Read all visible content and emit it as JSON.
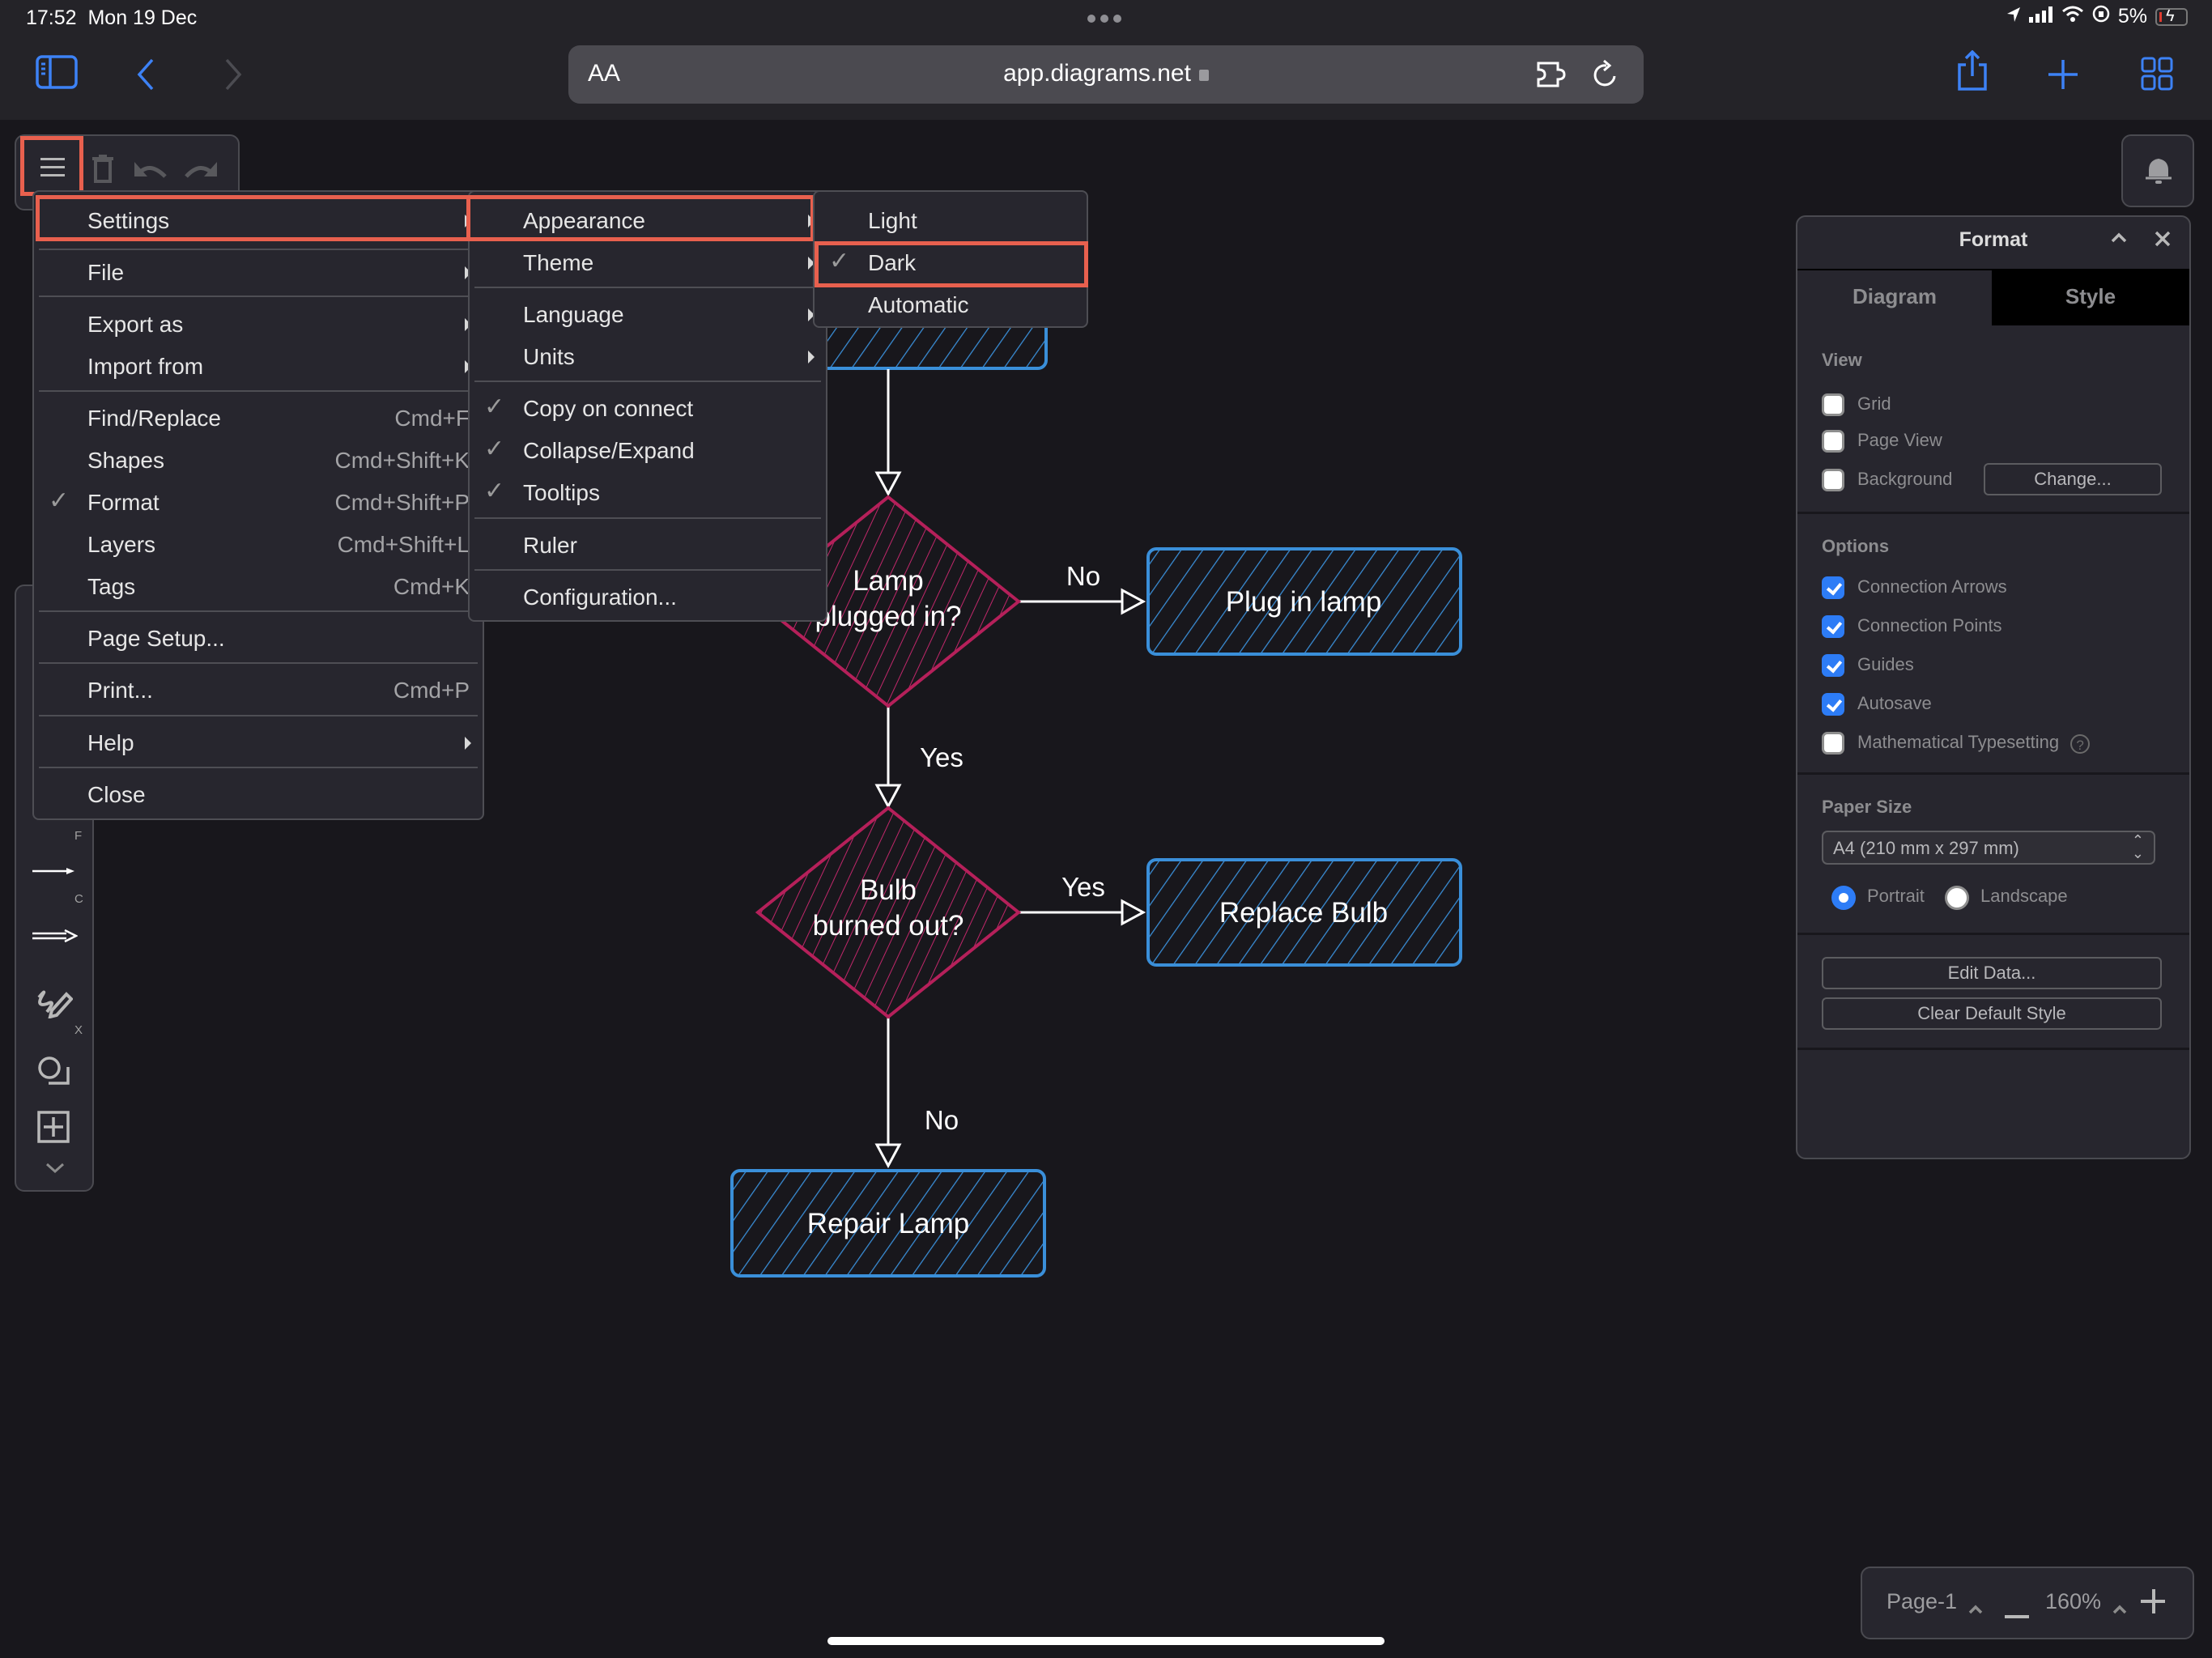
{
  "status_bar": {
    "time": "17:52",
    "date": "Mon 19 Dec",
    "battery": "5%"
  },
  "browser": {
    "text_size_label": "AA",
    "url": "app.diagrams.net",
    "icons": [
      "sidebar-icon",
      "back-icon",
      "forward-icon",
      "extension-icon",
      "reload-icon",
      "share-icon",
      "new-tab-icon",
      "tabs-overview-icon"
    ]
  },
  "toolbar": {
    "icons": [
      "menu-icon",
      "delete-icon",
      "undo-icon",
      "redo-icon"
    ]
  },
  "main_menu": {
    "items": [
      {
        "label": "Settings",
        "submenu": true,
        "highlighted": true
      },
      {
        "label": "File",
        "submenu": true
      },
      {
        "label": "Export as",
        "submenu": true
      },
      {
        "label": "Import from",
        "submenu": true
      },
      {
        "label": "Find/Replace",
        "shortcut": "Cmd+F"
      },
      {
        "label": "Shapes",
        "shortcut": "Cmd+Shift+K"
      },
      {
        "label": "Format",
        "shortcut": "Cmd+Shift+P",
        "checked": true
      },
      {
        "label": "Layers",
        "shortcut": "Cmd+Shift+L"
      },
      {
        "label": "Tags",
        "shortcut": "Cmd+K"
      },
      {
        "label": "Page Setup..."
      },
      {
        "label": "Print...",
        "shortcut": "Cmd+P"
      },
      {
        "label": "Help",
        "submenu": true
      },
      {
        "label": "Close"
      }
    ]
  },
  "settings_menu": {
    "items": [
      {
        "label": "Appearance",
        "submenu": true,
        "highlighted": true
      },
      {
        "label": "Theme",
        "submenu": true
      },
      {
        "label": "Language",
        "submenu": true
      },
      {
        "label": "Units",
        "submenu": true
      },
      {
        "label": "Copy on connect",
        "checked": true
      },
      {
        "label": "Collapse/Expand",
        "checked": true
      },
      {
        "label": "Tooltips",
        "checked": true
      },
      {
        "label": "Ruler"
      },
      {
        "label": "Configuration..."
      }
    ]
  },
  "appearance_menu": {
    "items": [
      {
        "label": "Light"
      },
      {
        "label": "Dark",
        "checked": true,
        "highlighted": true
      },
      {
        "label": "Automatic"
      }
    ]
  },
  "sidebar": {
    "shortcut_keys": [
      "F",
      "C",
      "X"
    ]
  },
  "diagram": {
    "nodes": [
      {
        "id": "decision1",
        "type": "diamond",
        "label_line1": "Lamp",
        "label_line2": "plugged in?"
      },
      {
        "id": "plug",
        "type": "rect",
        "label": "Plug in lamp"
      },
      {
        "id": "decision2",
        "type": "diamond",
        "label_line1": "Bulb",
        "label_line2": "burned out?"
      },
      {
        "id": "replace",
        "type": "rect",
        "label": "Replace Bulb"
      },
      {
        "id": "repair",
        "type": "rect",
        "label": "Repair Lamp"
      }
    ],
    "edges": [
      {
        "from": "decision1",
        "to": "plug",
        "label": "No"
      },
      {
        "from": "decision1",
        "to": "decision2",
        "label": "Yes"
      },
      {
        "from": "decision2",
        "to": "replace",
        "label": "Yes"
      },
      {
        "from": "decision2",
        "to": "repair",
        "label": "No"
      }
    ],
    "colors": {
      "rect": "#3a8fd9",
      "diamond": "#b5205a",
      "edge": "#ffffff"
    }
  },
  "format_panel": {
    "title": "Format",
    "tabs": [
      {
        "label": "Diagram",
        "active": true
      },
      {
        "label": "Style",
        "active": false
      }
    ],
    "view": {
      "title": "View",
      "grid": {
        "label": "Grid",
        "checked": false
      },
      "page_view": {
        "label": "Page View",
        "checked": false
      },
      "background": {
        "label": "Background",
        "checked": false
      },
      "change_button": "Change..."
    },
    "options": {
      "title": "Options",
      "items": [
        {
          "label": "Connection Arrows",
          "checked": true
        },
        {
          "label": "Connection Points",
          "checked": true
        },
        {
          "label": "Guides",
          "checked": true
        },
        {
          "label": "Autosave",
          "checked": true
        },
        {
          "label": "Mathematical Typesetting",
          "checked": false
        }
      ],
      "help_glyph": "?"
    },
    "paper_size": {
      "title": "Paper Size",
      "selected": "A4 (210 mm x 297 mm)",
      "portrait": {
        "label": "Portrait",
        "selected": true
      },
      "landscape": {
        "label": "Landscape",
        "selected": false
      }
    },
    "edit_data_button": "Edit Data...",
    "clear_style_button": "Clear Default Style"
  },
  "footer": {
    "page": "Page-1",
    "zoom": "160%"
  },
  "accent_colors": {
    "highlight": "#e8604e",
    "checkbox": "#2d7cf6",
    "safari_blue": "#3d82f6"
  }
}
